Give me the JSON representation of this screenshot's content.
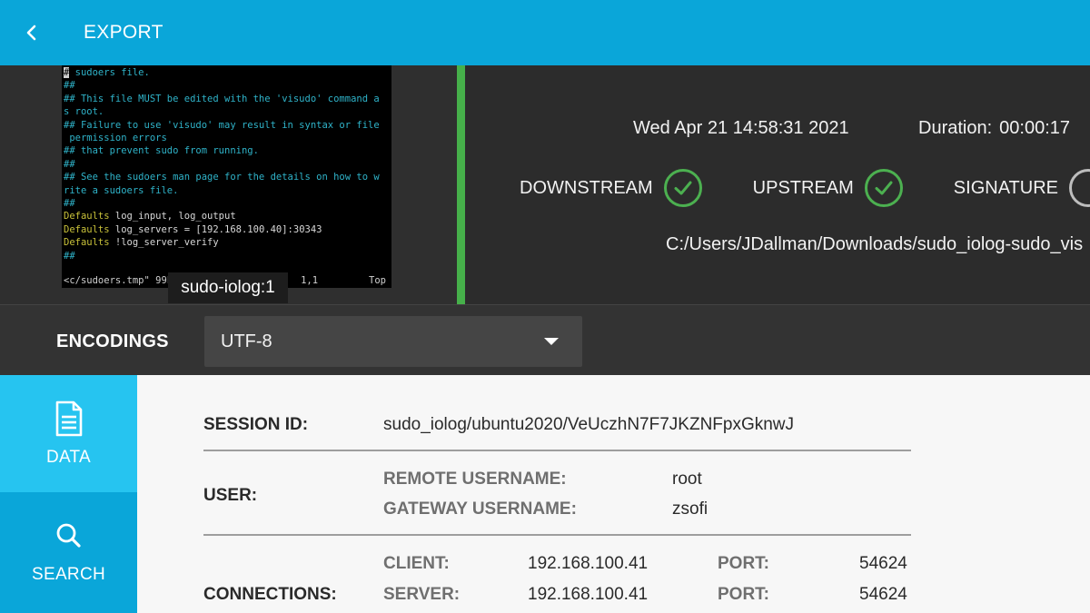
{
  "header": {
    "title": "EXPORT"
  },
  "terminal": {
    "lines": [
      "# sudoers file.",
      "##",
      "## This file MUST be edited with the 'visudo' command a",
      "s root.",
      "## Failure to use 'visudo' may result in syntax or file",
      " permission errors",
      "## that prevent sudo from running.",
      "##",
      "## See the sudoers man page for the details on how to w",
      "rite a sudoers file.",
      "##"
    ],
    "defaults": [
      {
        "kw": "Defaults",
        "rest": " log_input, log_output"
      },
      {
        "kw": "Defaults",
        "rest": " log_servers = [192.168.100.40]:30343"
      },
      {
        "kw": "Defaults",
        "rest": " !log_server_verify"
      }
    ],
    "after": [
      "",
      "##"
    ],
    "status_left": "<c/sudoers.tmp\" 99L, 30",
    "status_mid": "1,1",
    "status_right": "Top",
    "label": "sudo-iolog:1"
  },
  "meta": {
    "timestamp": "Wed Apr 21 14:58:31 2021",
    "duration_label": "Duration:",
    "duration_value": "00:00:17",
    "statuses": [
      "DOWNSTREAM",
      "UPSTREAM",
      "SIGNATURE"
    ],
    "path": "C:/Users/JDallman/Downloads/sudo_iolog-sudo_vis"
  },
  "encodings": {
    "label": "ENCODINGS",
    "selected": "UTF-8"
  },
  "nav": {
    "data_label": "DATA",
    "search_label": "SEARCH"
  },
  "details": {
    "session_id_key": "SESSION ID:",
    "session_id": "sudo_iolog/ubuntu2020/VeUczhN7F7JKZNFpxGknwJ",
    "user_key": "USER:",
    "remote_username_key": "REMOTE USERNAME:",
    "remote_username": "root",
    "gateway_username_key": "GATEWAY USERNAME:",
    "gateway_username": "zsofi",
    "connections_key": "CONNECTIONS:",
    "client_key": "CLIENT:",
    "client_ip": "192.168.100.41",
    "server_key": "SERVER:",
    "server_ip": "192.168.100.41",
    "port_key": "PORT:",
    "client_port": "54624",
    "server_port": "54624"
  },
  "colors": {
    "accent": "#0aa6d9",
    "nav_active": "#26c4f0",
    "success": "#4cb050"
  }
}
